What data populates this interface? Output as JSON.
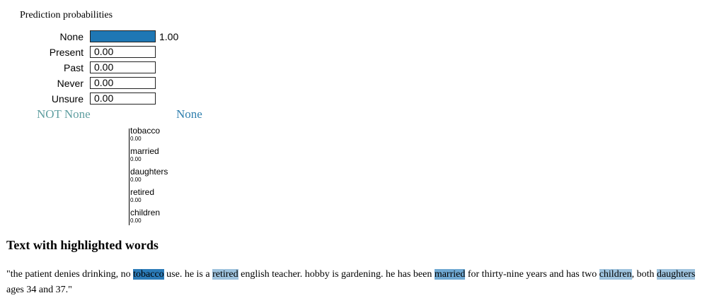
{
  "prediction": {
    "title": "Prediction probabilities",
    "bar_color": "#1f77b4"
  },
  "chart_data": {
    "type": "bar",
    "orientation": "horizontal",
    "title": "Prediction probabilities",
    "categories": [
      "None",
      "Present",
      "Past",
      "Never",
      "Unsure"
    ],
    "values": [
      1.0,
      0.0,
      0.0,
      0.0,
      0.0
    ],
    "value_labels": [
      "1.00",
      "0.00",
      "0.00",
      "0.00",
      "0.00"
    ],
    "xlim": [
      0,
      1
    ]
  },
  "explanation": {
    "negative_class": "NOT None",
    "positive_class": "None",
    "negative_color": "#5f9ea0",
    "positive_color": "#2f7fae",
    "features": [
      {
        "name": "tobacco",
        "value": "0.00"
      },
      {
        "name": "married",
        "value": "0.00"
      },
      {
        "name": "daughters",
        "value": "0.00"
      },
      {
        "name": "retired",
        "value": "0.00"
      },
      {
        "name": "children",
        "value": "0.00"
      }
    ]
  },
  "text_section": {
    "heading": "Text with highlighted words",
    "segments": [
      {
        "text": "\"the patient denies drinking, no ",
        "hl": ""
      },
      {
        "text": "tobacco",
        "hl": "hl-strong"
      },
      {
        "text": " use. he is a ",
        "hl": ""
      },
      {
        "text": "retired",
        "hl": "hl"
      },
      {
        "text": " english teacher.  hobby is gardening.  he has been ",
        "hl": ""
      },
      {
        "text": "married",
        "hl": "hl-mid"
      },
      {
        "text": " for thirty-nine years and has two ",
        "hl": ""
      },
      {
        "text": "children",
        "hl": "hl"
      },
      {
        "text": ", both ",
        "hl": ""
      },
      {
        "text": "daughters",
        "hl": "hl"
      },
      {
        "text": " ages 34 and 37.\"",
        "hl": ""
      }
    ]
  }
}
